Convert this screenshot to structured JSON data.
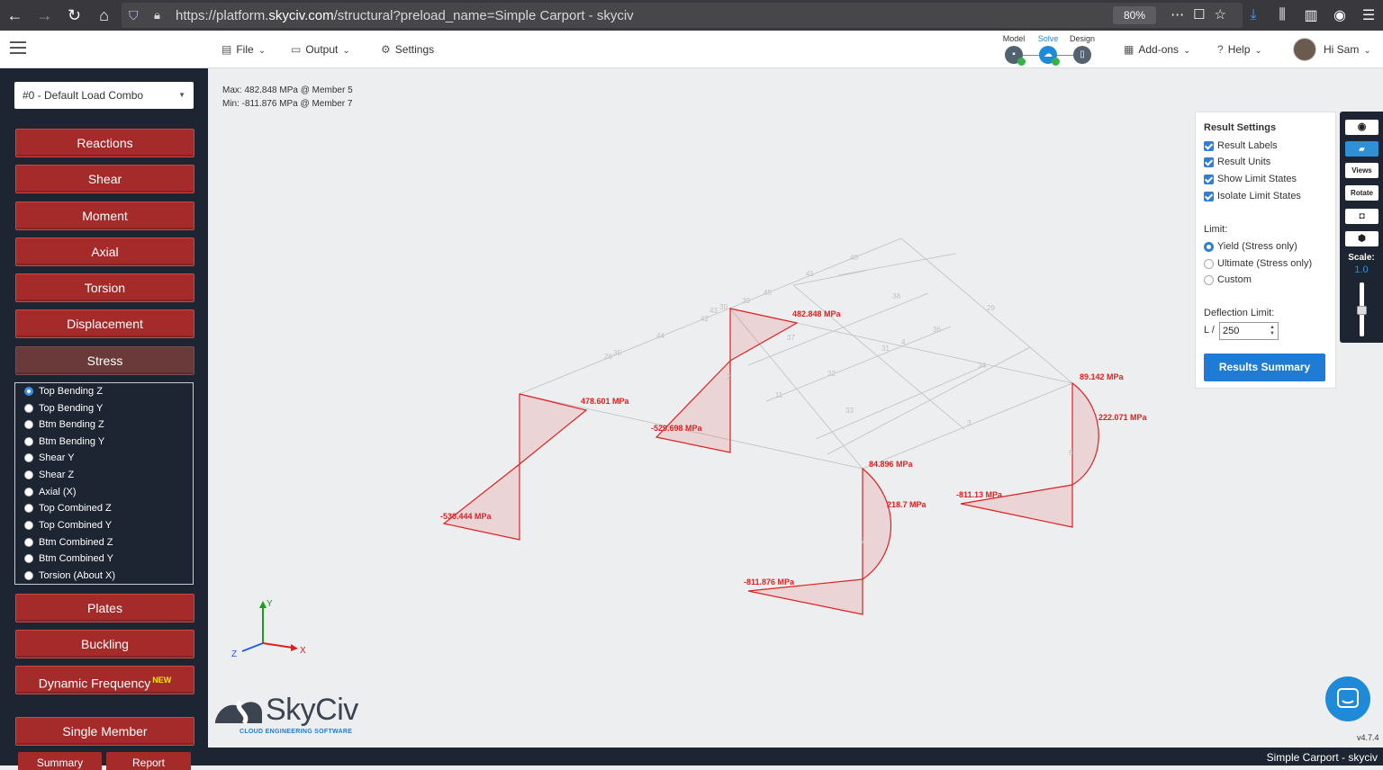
{
  "browser": {
    "url_prefix": "https://platform.",
    "url_domain": "skyciv.com",
    "url_path": "/structural?preload_name=Simple Carport - skyciv",
    "zoom": "80%"
  },
  "header": {
    "file_label": "File",
    "output_label": "Output",
    "settings_label": "Settings",
    "stages": {
      "model": "Model",
      "solve": "Solve",
      "design": "Design"
    },
    "addons_label": "Add-ons",
    "help_label": "Help",
    "user_greeting": "Hi Sam"
  },
  "sidebar": {
    "load_combo": "#0 - Default Load Combo",
    "buttons": {
      "reactions": "Reactions",
      "shear": "Shear",
      "moment": "Moment",
      "axial": "Axial",
      "torsion": "Torsion",
      "displacement": "Displacement",
      "stress": "Stress",
      "plates": "Plates",
      "buckling": "Buckling",
      "dynamic": "Dynamic Frequency",
      "dynamic_badge": "NEW",
      "single_member": "Single Member",
      "summary": "Summary",
      "report": "Report"
    },
    "stress_options": [
      "Top Bending Z",
      "Top Bending Y",
      "Btm Bending Z",
      "Btm Bending Y",
      "Shear Y",
      "Shear Z",
      "Axial (X)",
      "Top Combined Z",
      "Top Combined Y",
      "Btm Combined Z",
      "Btm Combined Y",
      "Torsion (About X)"
    ],
    "selected_option": "Top Bending Z"
  },
  "canvas": {
    "max_text": "Max: 482.848 MPa @ Member 5",
    "min_text": "Min: -811.876 MPa @ Member 7",
    "labels": {
      "l1": "482.848 MPa",
      "l2": "478.601 MPa",
      "l3": "-529.698 MPa",
      "l4": "-530.444 MPa",
      "l5": "89.142 MPa",
      "l6": "222.071 MPa",
      "l7": "84.896 MPa",
      "l8": "218.7 MPa",
      "l9": "-811.13 MPa",
      "l10": "-811.876 MPa"
    },
    "member_ids": {
      "a": "38",
      "b": "4",
      "c": "36",
      "d": "34",
      "e": "33",
      "f": "3",
      "g": "32",
      "h": "11",
      "i": "44",
      "j": "28",
      "k": "35",
      "l": "45",
      "m": "41",
      "n": "40",
      "o": "29",
      "p": "31",
      "q": "39",
      "r": "43",
      "s": "42",
      "t": "30",
      "u": "37",
      "v": "8",
      "w": "7",
      "x": "2"
    },
    "axes": {
      "x": "X",
      "y": "Y",
      "z": "Z"
    },
    "logo_name": "SkyCiv",
    "logo_tagline": "CLOUD ENGINEERING SOFTWARE",
    "version": "v4.7.4"
  },
  "result_settings": {
    "title": "Result Settings",
    "checks": [
      "Result Labels",
      "Result Units",
      "Show Limit States",
      "Isolate Limit States"
    ],
    "limit_label": "Limit:",
    "limit_options": [
      "Yield (Stress only)",
      "Ultimate (Stress only)",
      "Custom"
    ],
    "selected_limit": "Yield (Stress only)",
    "deflection_label": "Deflection Limit:",
    "deflection_prefix": "L /",
    "deflection_value": "250",
    "summary_button": "Results Summary"
  },
  "toolbox": {
    "views": "Views",
    "rotate": "Rotate",
    "scale_label": "Scale:",
    "scale_value": "1.0"
  },
  "status": {
    "title": "Simple Carport - skyciv"
  },
  "colors": {
    "accent": "#1f7bd4",
    "sidebar": "#1c2531",
    "button": "#a52a2a",
    "result": "#e02020"
  }
}
